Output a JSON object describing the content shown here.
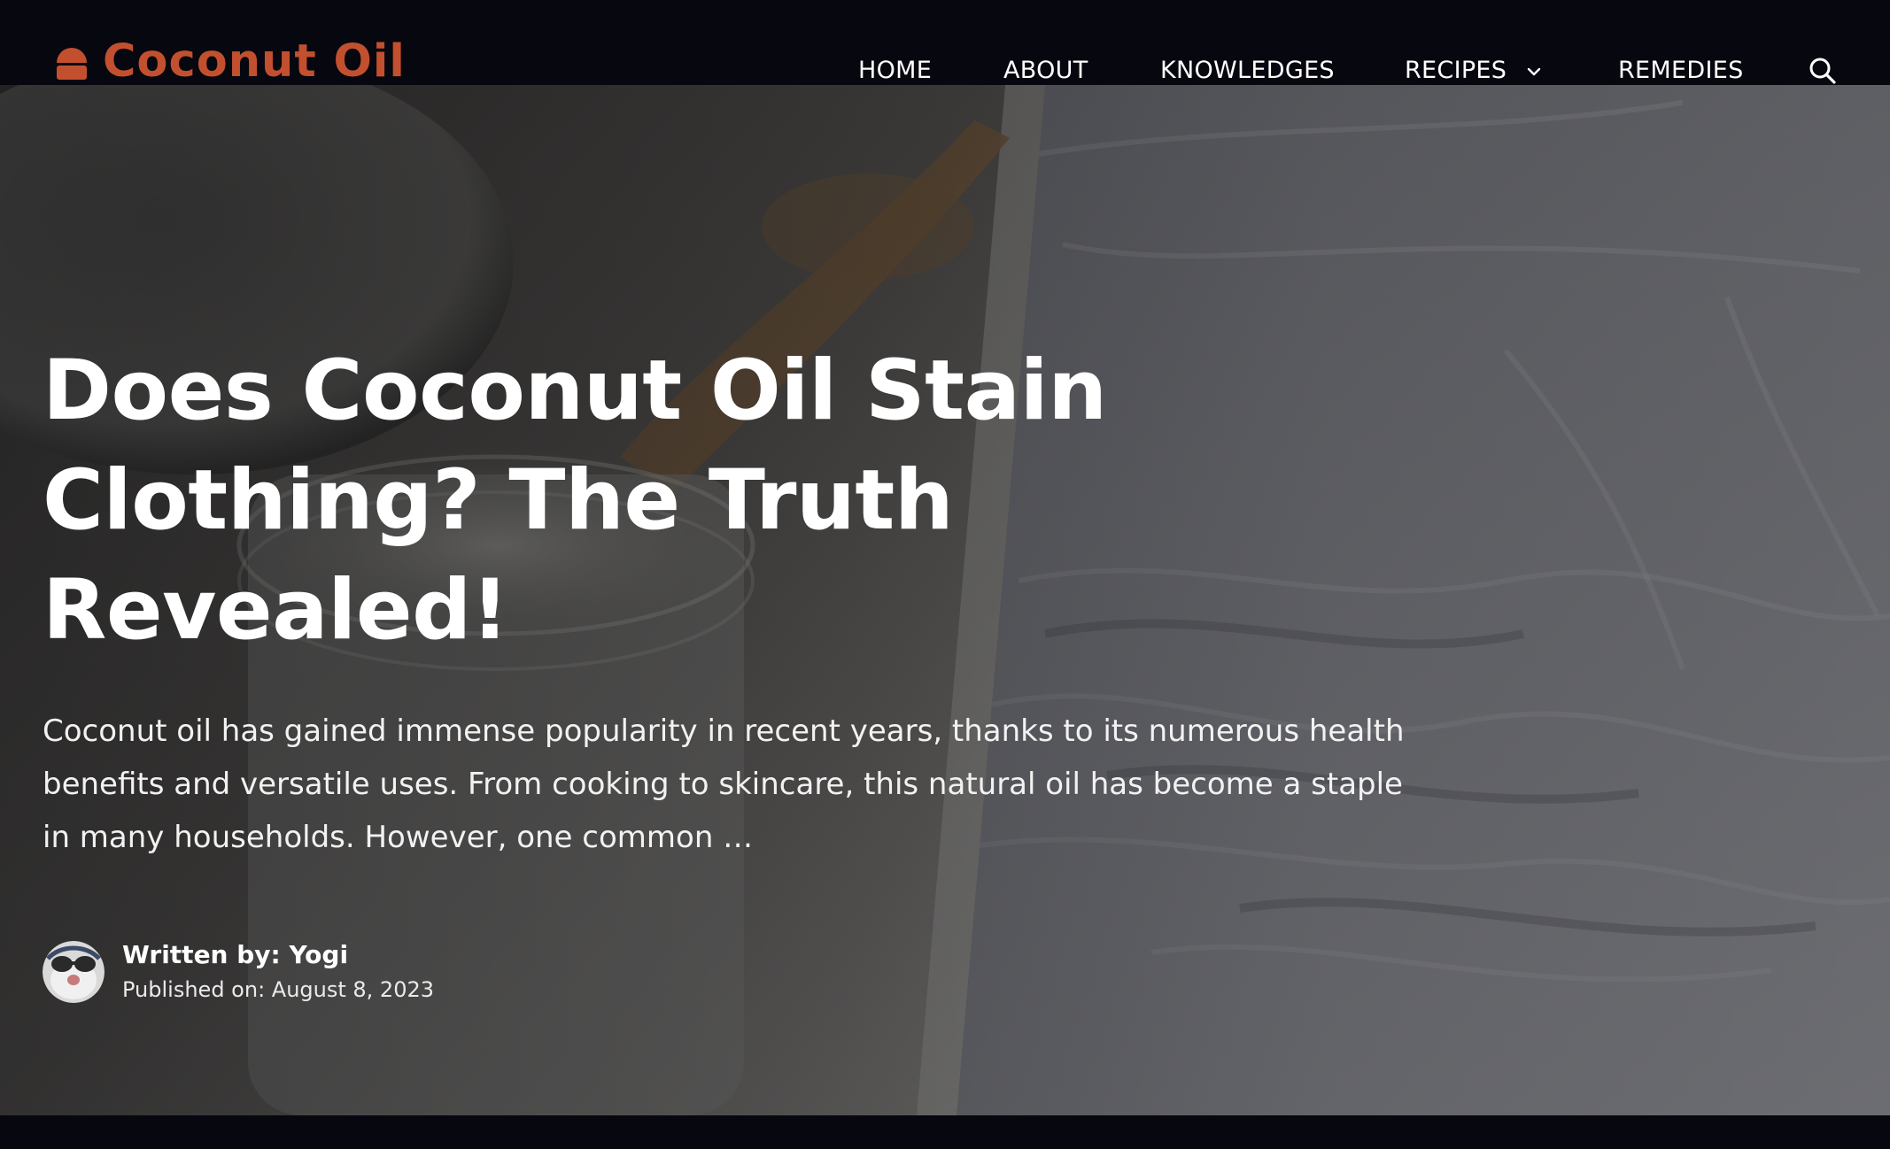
{
  "site": {
    "logo_text": "Coconut Oil",
    "brand_color": "#c2502f"
  },
  "nav": {
    "items": [
      {
        "label": "HOME"
      },
      {
        "label": "ABOUT"
      },
      {
        "label": "KNOWLEDGES"
      },
      {
        "label": "RECIPES",
        "has_dropdown": true
      },
      {
        "label": "REMEDIES"
      }
    ],
    "search_icon": "search-icon",
    "dropdown_icon": "chevron-down-icon"
  },
  "article": {
    "title": "Does Coconut Oil Stain Clothing? The Truth Revealed!",
    "excerpt": "Coconut oil has gained immense popularity in recent years, thanks to its numerous health benefits and versatile uses. From cooking to skincare, this natural oil has become a staple in many households. However, one common …",
    "author_line": "Written by: Yogi",
    "published_line": "Published on: August 8, 2023"
  },
  "colors": {
    "header_bg": "#07070f",
    "text": "#ffffff"
  }
}
